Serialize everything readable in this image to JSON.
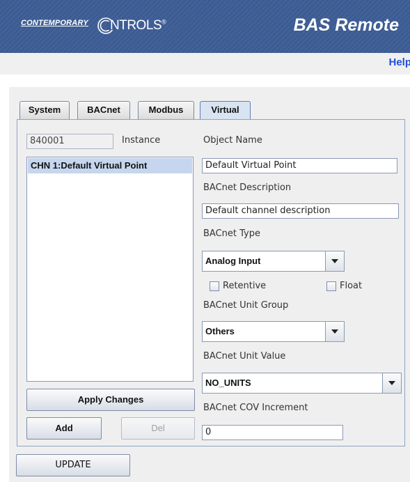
{
  "header": {
    "logo_left": "CONTEMPORARY",
    "logo_right": "NTROLS",
    "logo_trademark": "®",
    "product_title": "BAS Remote"
  },
  "helpbar": {
    "help_label": "Help"
  },
  "tabs": [
    {
      "label": "System",
      "active": false
    },
    {
      "label": "BACnet",
      "active": false
    },
    {
      "label": "Modbus",
      "active": false
    },
    {
      "label": "Virtual",
      "active": true
    }
  ],
  "virtual": {
    "instance_value": "840001",
    "instance_label": "Instance",
    "points": [
      "CHN 1:Default Virtual Point"
    ],
    "apply_changes_label": "Apply Changes",
    "add_label": "Add",
    "del_label": "Del",
    "object_name_label": "Object Name",
    "object_name_value": "Default Virtual Point",
    "description_label": "BACnet Description",
    "description_value": "Default channel description",
    "type_label": "BACnet Type",
    "type_value": "Analog Input",
    "retentive_label": "Retentive",
    "retentive_checked": false,
    "float_label": "Float",
    "float_checked": false,
    "unit_group_label": "BACnet Unit Group",
    "unit_group_value": "Others",
    "unit_value_label": "BACnet Unit Value",
    "unit_value_value": "NO_UNITS",
    "cov_increment_label": "BACnet COV Increment",
    "cov_increment_value": "0"
  },
  "update_label": "UPDATE",
  "colors": {
    "header_bg": "#3b5b93",
    "help_link": "#2050d8",
    "selected_row": "#c6d6ee",
    "panel_bg": "#efefef"
  }
}
